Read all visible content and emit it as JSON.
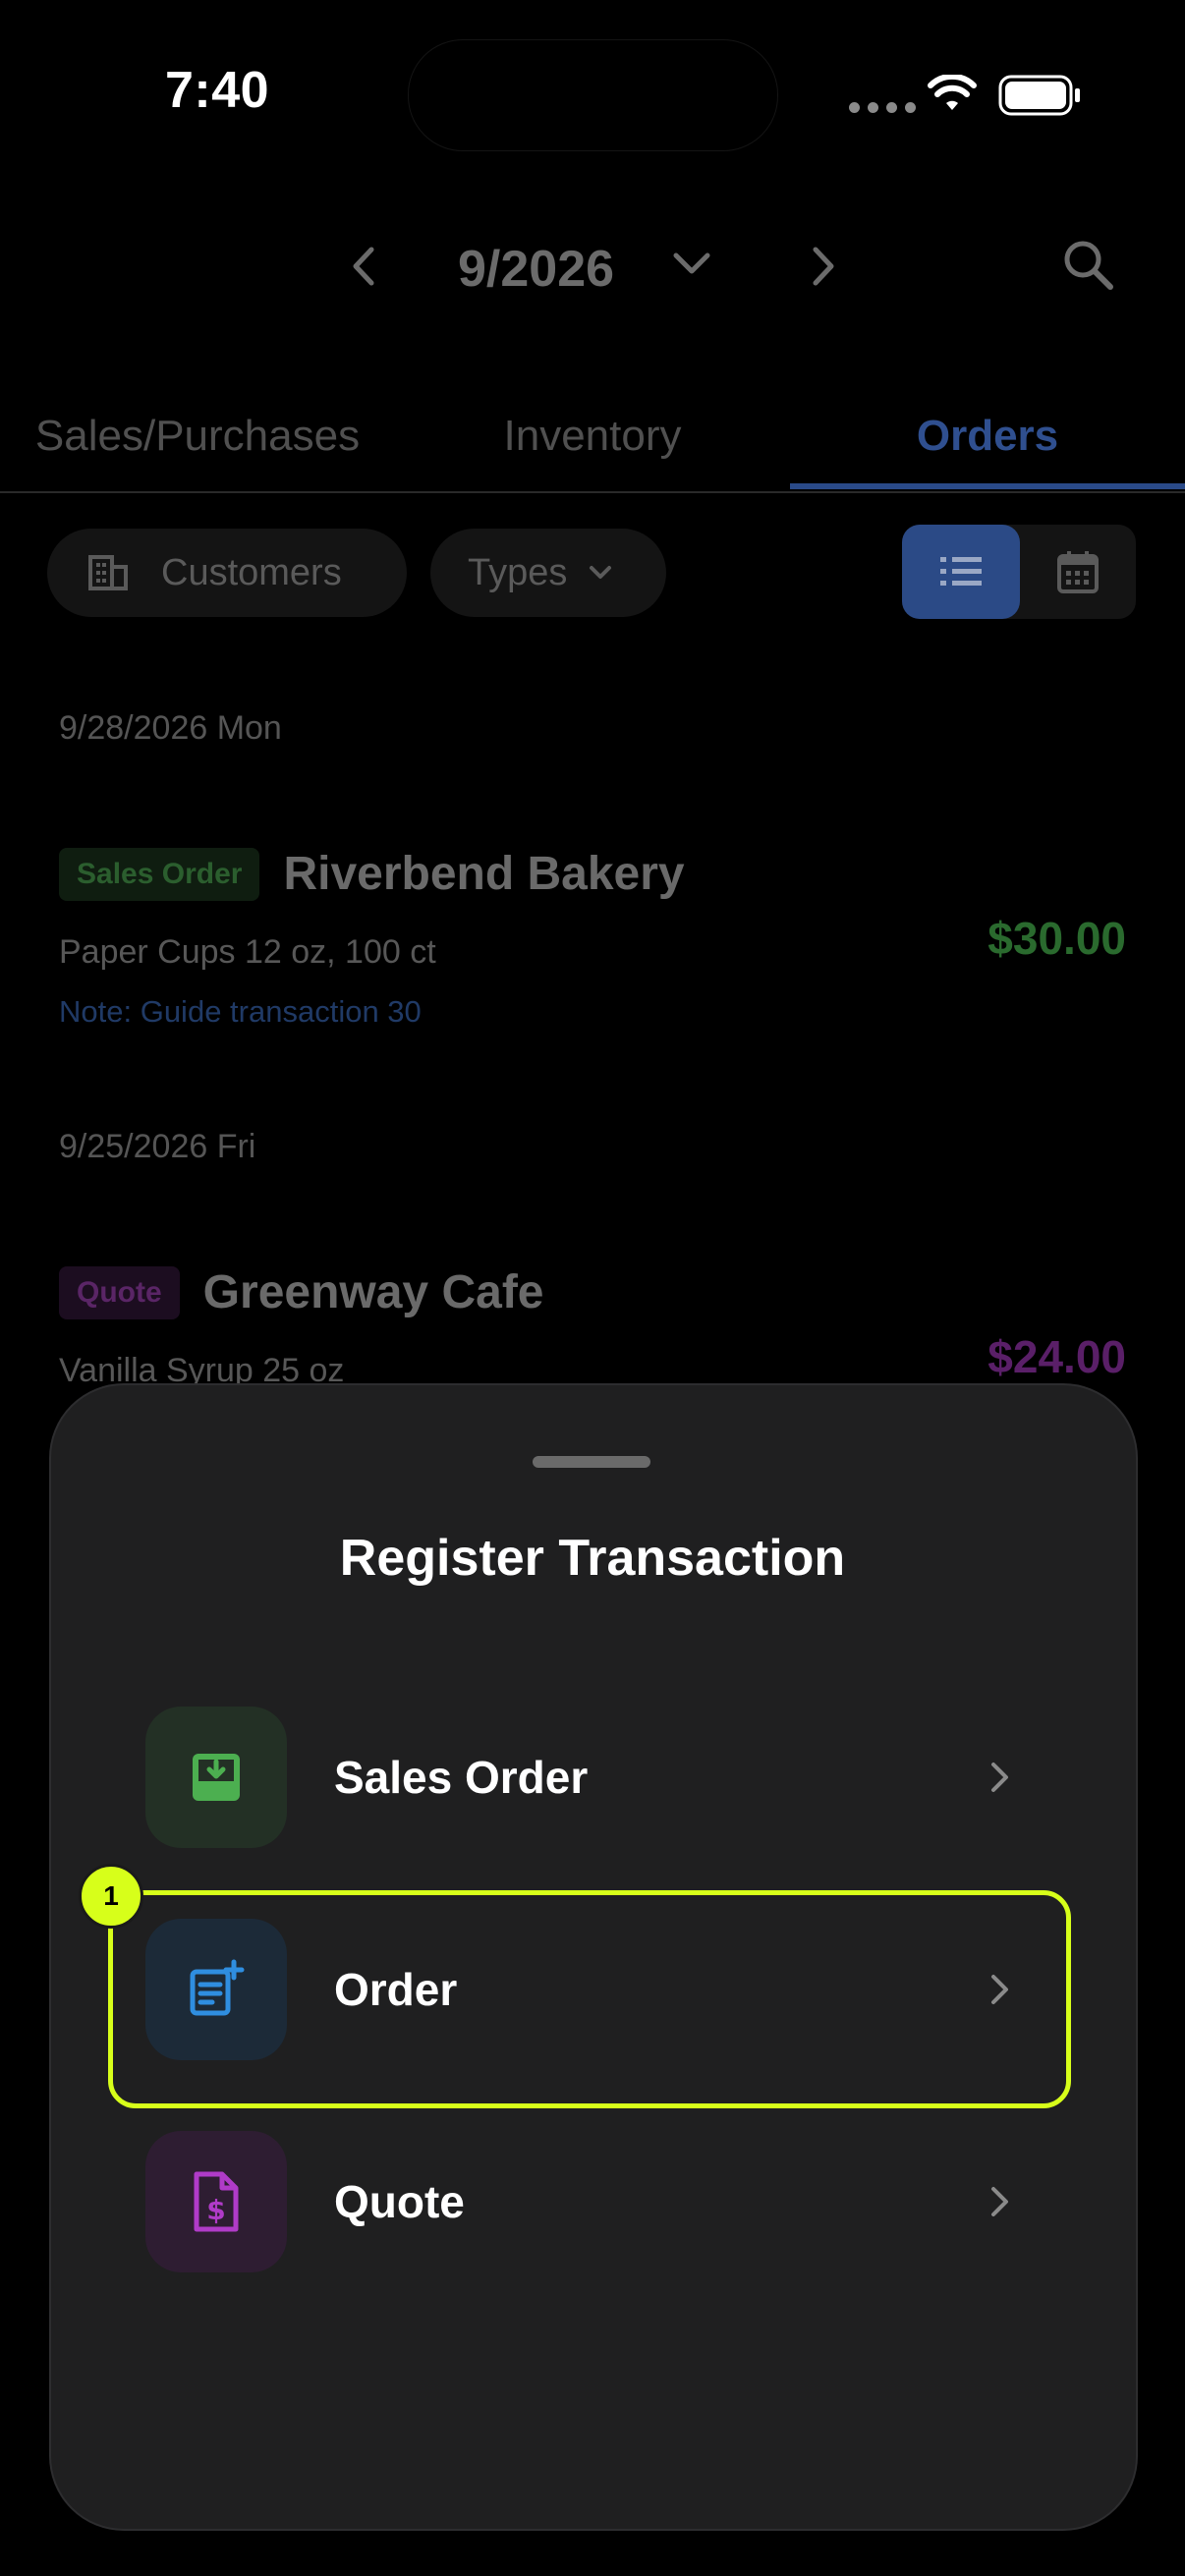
{
  "status_bar": {
    "time": "7:40"
  },
  "header": {
    "month": "9/2026"
  },
  "tabs": [
    {
      "label": "Sales/Purchases"
    },
    {
      "label": "Inventory"
    },
    {
      "label": "Orders"
    }
  ],
  "filters": {
    "customers_label": "Customers",
    "types_label": "Types"
  },
  "groups": [
    {
      "date": "9/28/2026 Mon",
      "badge": "Sales Order",
      "customer": "Riverbend Bakery",
      "item": "Paper Cups 12 oz, 100 ct",
      "note": "Note: Guide transaction 30",
      "amount": "$30.00"
    },
    {
      "date": "9/25/2026 Fri",
      "badge": "Quote",
      "customer": "Greenway Cafe",
      "item": "Vanilla Syrup 25 oz",
      "amount": "$24.00"
    }
  ],
  "sheet": {
    "title": "Register Transaction",
    "options": [
      {
        "label": "Sales Order",
        "icon": "tray-download-icon"
      },
      {
        "label": "Order",
        "icon": "note-add-icon"
      },
      {
        "label": "Quote",
        "icon": "dollar-document-icon"
      }
    ]
  },
  "highlight": {
    "number": "1"
  },
  "colors": {
    "sales_green": "#4caf50",
    "order_blue": "#2f8ee0",
    "quote_purple": "#b03bc8",
    "highlight": "#d7ff1a",
    "accent_blue": "#2f4f8f"
  }
}
